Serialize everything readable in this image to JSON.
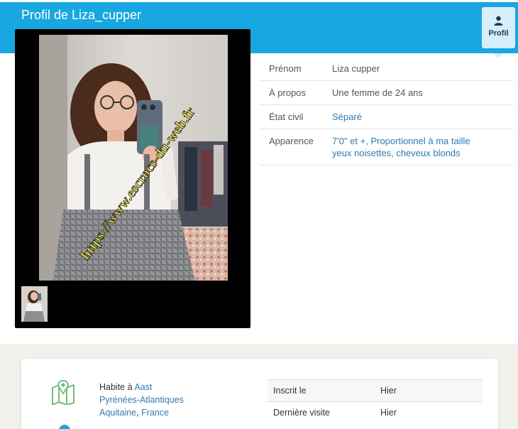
{
  "header": {
    "title": "Profil de Liza_cupper",
    "tab_label": "Profil",
    "tab_icon": "user-icon",
    "color": "#18a7e0"
  },
  "photo": {
    "watermark": "https://www.escrocs-du-web.fr"
  },
  "info": {
    "rows": [
      {
        "label": "Prénom",
        "value": "Liza cupper"
      },
      {
        "label": "À propos",
        "value": "Une femme de 24 ans"
      },
      {
        "label": "État civil",
        "value": "Séparé"
      },
      {
        "label": "Apparence",
        "value_line1": "7'0\" et +, Proportionnel à ma taille",
        "value_line2": "yeux noisettes, cheveux blonds"
      }
    ]
  },
  "location": {
    "prefix": "Habite à",
    "city": "Aast",
    "department": "Pyrénées-Atlantiques",
    "region": "Aquitaine",
    "separator": ",",
    "country": "France",
    "icon": "map-pin-icon"
  },
  "stats": {
    "rows": [
      {
        "label": "Inscrit le",
        "value": "Hier"
      },
      {
        "label": "Dernière visite",
        "value": "Hier"
      }
    ]
  }
}
